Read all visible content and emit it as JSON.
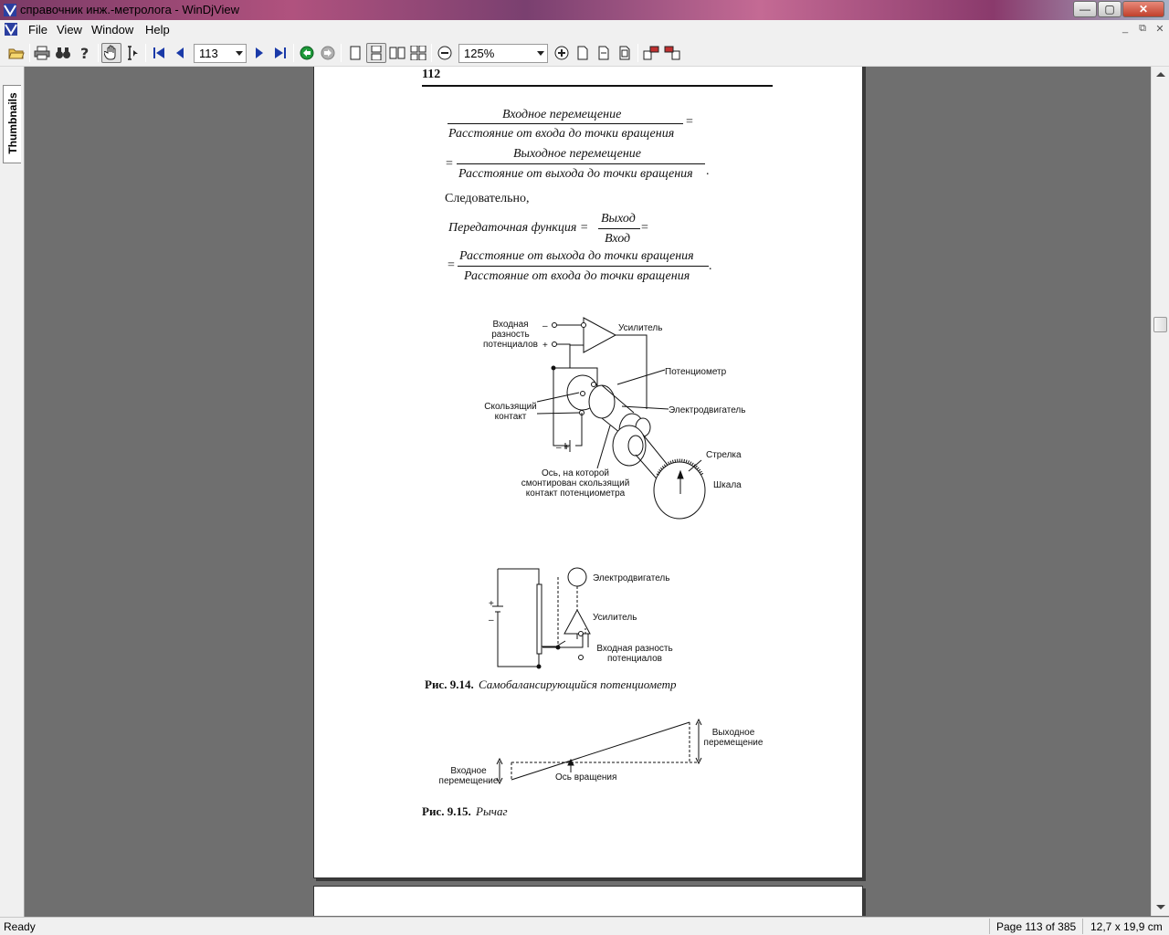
{
  "window": {
    "title": "справочник инж.-метролога - WinDjView",
    "controls": {
      "minimize": "—",
      "maximize": "▢",
      "close": "✕"
    }
  },
  "menu": {
    "items": [
      "File",
      "View",
      "Window",
      "Help"
    ],
    "mdi_controls": {
      "minimize": "_",
      "restore": "⧉",
      "close": "✕"
    }
  },
  "toolbar": {
    "page_number": "113",
    "zoom": "125%"
  },
  "sidebar": {
    "tab_label": "Thumbnails"
  },
  "document": {
    "page_number_header": "112",
    "formula1": {
      "num1": "Входное перемещение",
      "den1": "Расстояние от входа до точки вращения",
      "op1": "=",
      "op2": "=",
      "num2": "Выходное перемещение",
      "den2": "Расстояние от выхода до точки вращения",
      "end": "."
    },
    "consequently": "Следовательно,",
    "formula2": {
      "lhs": "Передаточная функция =",
      "num": "Выход",
      "den": "Вход",
      "op": "=",
      "op2": "=",
      "num2": "Расстояние от выхода до точки вращения",
      "den2": "Расстояние от входа до точки вращения",
      "end": "."
    },
    "fig1_labels": {
      "input_diff": "Входная\nразность\nпотенциалов",
      "minus": "–",
      "plus": "+",
      "amplifier": "Усилитель",
      "potentiometer": "Потенциометр",
      "sliding_contact": "Скользящий\nконтакт",
      "motor": "Электродвигатель",
      "battery": "– +",
      "pointer": "Стрелка",
      "scale": "Шкала",
      "axis": "Ось, на которой\nсмонтирован скользящий\nконтакт потенциометра"
    },
    "fig2_labels": {
      "motor": "Электродвигатель",
      "amplifier": "Усилитель",
      "input_diff": "Входная разность\nпотенциалов",
      "plus": "+",
      "minus": "–"
    },
    "caption_914_num": "Рис. 9.14.",
    "caption_914_text": "Самобалансирующийся потенциометр",
    "fig3_labels": {
      "output": "Выходное\nперемещение",
      "input": "Входное\nперемещение",
      "pivot": "Ось вращения"
    },
    "caption_915_num": "Рис. 9.15.",
    "caption_915_text": "Рычаг"
  },
  "status": {
    "left": "Ready",
    "page": "Page 113 of 385",
    "size": "12,7 x 19,9 cm"
  }
}
